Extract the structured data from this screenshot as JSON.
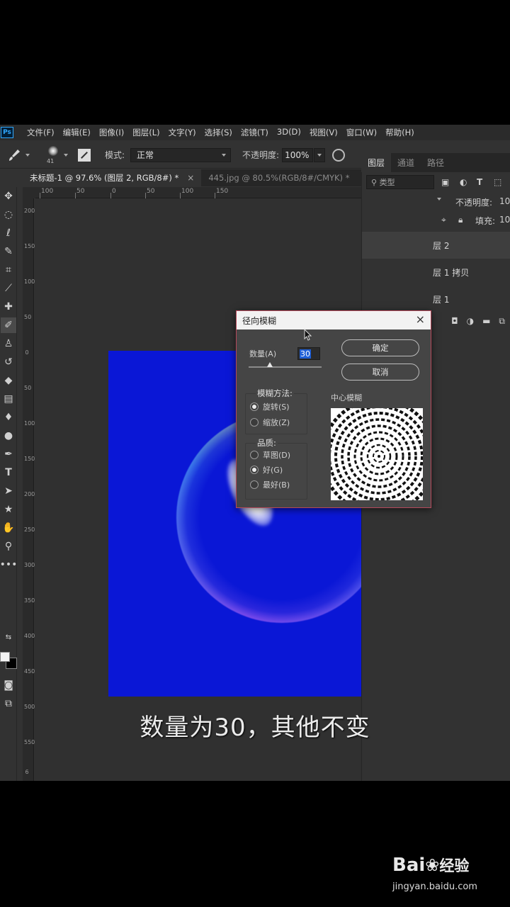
{
  "menubar": {
    "logo": "Ps",
    "items": [
      "文件(F)",
      "编辑(E)",
      "图像(I)",
      "图层(L)",
      "文字(Y)",
      "选择(S)",
      "滤镜(T)",
      "3D(D)",
      "视图(V)",
      "窗口(W)",
      "帮助(H)"
    ]
  },
  "options": {
    "brush_size": "41",
    "mode_label": "模式:",
    "mode_value": "正常",
    "opacity_label": "不透明度:",
    "opacity_value": "100%"
  },
  "tabs": [
    {
      "label": "未标题-1 @ 97.6% (图层 2, RGB/8#) *",
      "close": "×"
    },
    {
      "label": "445.jpg @ 80.5%(RGB/8#/CMYK) *"
    }
  ],
  "ruler_top": [
    "100",
    "50",
    "0",
    "50",
    "100",
    "150"
  ],
  "ruler_left": [
    "200",
    "150",
    "100",
    "50",
    "0",
    "50",
    "100",
    "150",
    "200",
    "250",
    "300",
    "350",
    "400",
    "450",
    "500",
    "550",
    "6"
  ],
  "layers_panel": {
    "tabs": [
      "图层",
      "通道",
      "路径"
    ],
    "filter_label": "类型",
    "opacity_label": "不透明度:",
    "opacity_value": "10",
    "fill_label": "填充:",
    "fill_value": "10",
    "layer_names": [
      "层 2",
      "层 1 拷贝",
      "层 1"
    ]
  },
  "dialog": {
    "title": "径向模糊",
    "close": "×",
    "amount_label": "数量(A)",
    "amount_value": "30",
    "ok_label": "确定",
    "cancel_label": "取消",
    "method_legend": "模糊方法:",
    "method_options": [
      "旋转(S)",
      "缩放(Z)"
    ],
    "method_selected": "旋转(S)",
    "quality_legend": "品质:",
    "quality_options": [
      "草图(D)",
      "好(G)",
      "最好(B)"
    ],
    "quality_selected": "好(G)",
    "center_label": "中心模糊"
  },
  "caption": "数量为30，其他不变",
  "watermark": {
    "brand": "Bai",
    "brand_suffix": "经验",
    "url": "jingyan.baidu.com"
  },
  "colors": {
    "canvas_blue": "#0a17d6",
    "ps_bg": "#323232",
    "dialog_bg": "#454545",
    "accent_blue": "#31a8ff"
  },
  "icons": [
    "move-icon",
    "marquee-icon",
    "lasso-icon",
    "quick-select-icon",
    "crop-icon",
    "eyedropper-icon",
    "healing-icon",
    "brush-icon",
    "stamp-icon",
    "history-brush-icon",
    "eraser-icon",
    "gradient-icon",
    "blur-icon",
    "dodge-icon",
    "pen-icon",
    "type-icon",
    "path-select-icon",
    "shape-icon",
    "hand-icon",
    "zoom-icon",
    "more-icon"
  ]
}
